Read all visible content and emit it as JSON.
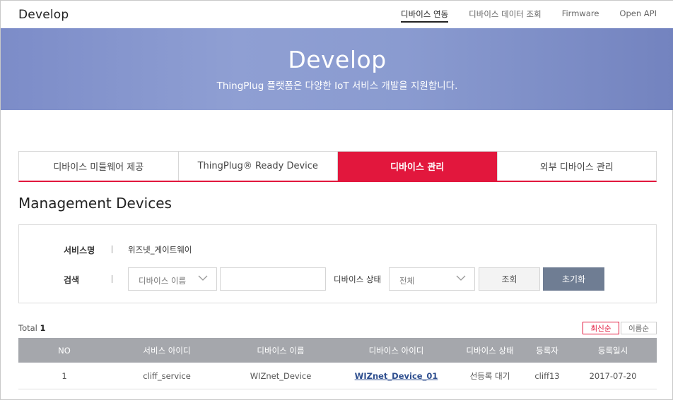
{
  "brand": "Develop",
  "topnav": [
    {
      "label": "디바이스 연동",
      "active": true
    },
    {
      "label": "디바이스 데이터 조회",
      "active": false
    },
    {
      "label": "Firmware",
      "active": false
    },
    {
      "label": "Open API",
      "active": false
    }
  ],
  "hero": {
    "title": "Develop",
    "subtitle": "ThingPlug 플랫폼은 다양한 IoT 서비스 개발을 지원합니다."
  },
  "tabs": [
    {
      "label": "디바이스 미들웨어 제공",
      "active": false
    },
    {
      "label": "ThingPlug® Ready Device",
      "active": false
    },
    {
      "label": "디바이스 관리",
      "active": true
    },
    {
      "label": "외부 디바이스 관리",
      "active": false
    }
  ],
  "section_title": "Management Devices",
  "filter": {
    "service_label": "서비스명",
    "service_value": "위즈넷_게이트웨이",
    "search_label": "검색",
    "search_select": "디바이스 이름",
    "search_input_value": "",
    "status_label": "디바이스 상태",
    "status_select": "전체",
    "search_button": "조회",
    "reset_button": "초기화"
  },
  "total": {
    "label": "Total",
    "count": "1"
  },
  "sort": {
    "newest": "최신순",
    "name": "이름순"
  },
  "table": {
    "headers": [
      "NO",
      "서비스 아이디",
      "디바이스 이름",
      "디바이스 아이디",
      "디바이스 상태",
      "등록자",
      "등록일시"
    ],
    "rows": [
      [
        "1",
        "cliff_service",
        "WIZnet_Device",
        "WIZnet_Device_01",
        "선등록 대기",
        "cliff13",
        "2017-07-20"
      ]
    ]
  },
  "colors": {
    "accent": "#e2173d",
    "hero": "#8a9bd0",
    "reset_button": "#6f7d93",
    "table_header": "#a5a7ac"
  },
  "icons": {
    "select_chevron": "chevron-down-icon"
  }
}
